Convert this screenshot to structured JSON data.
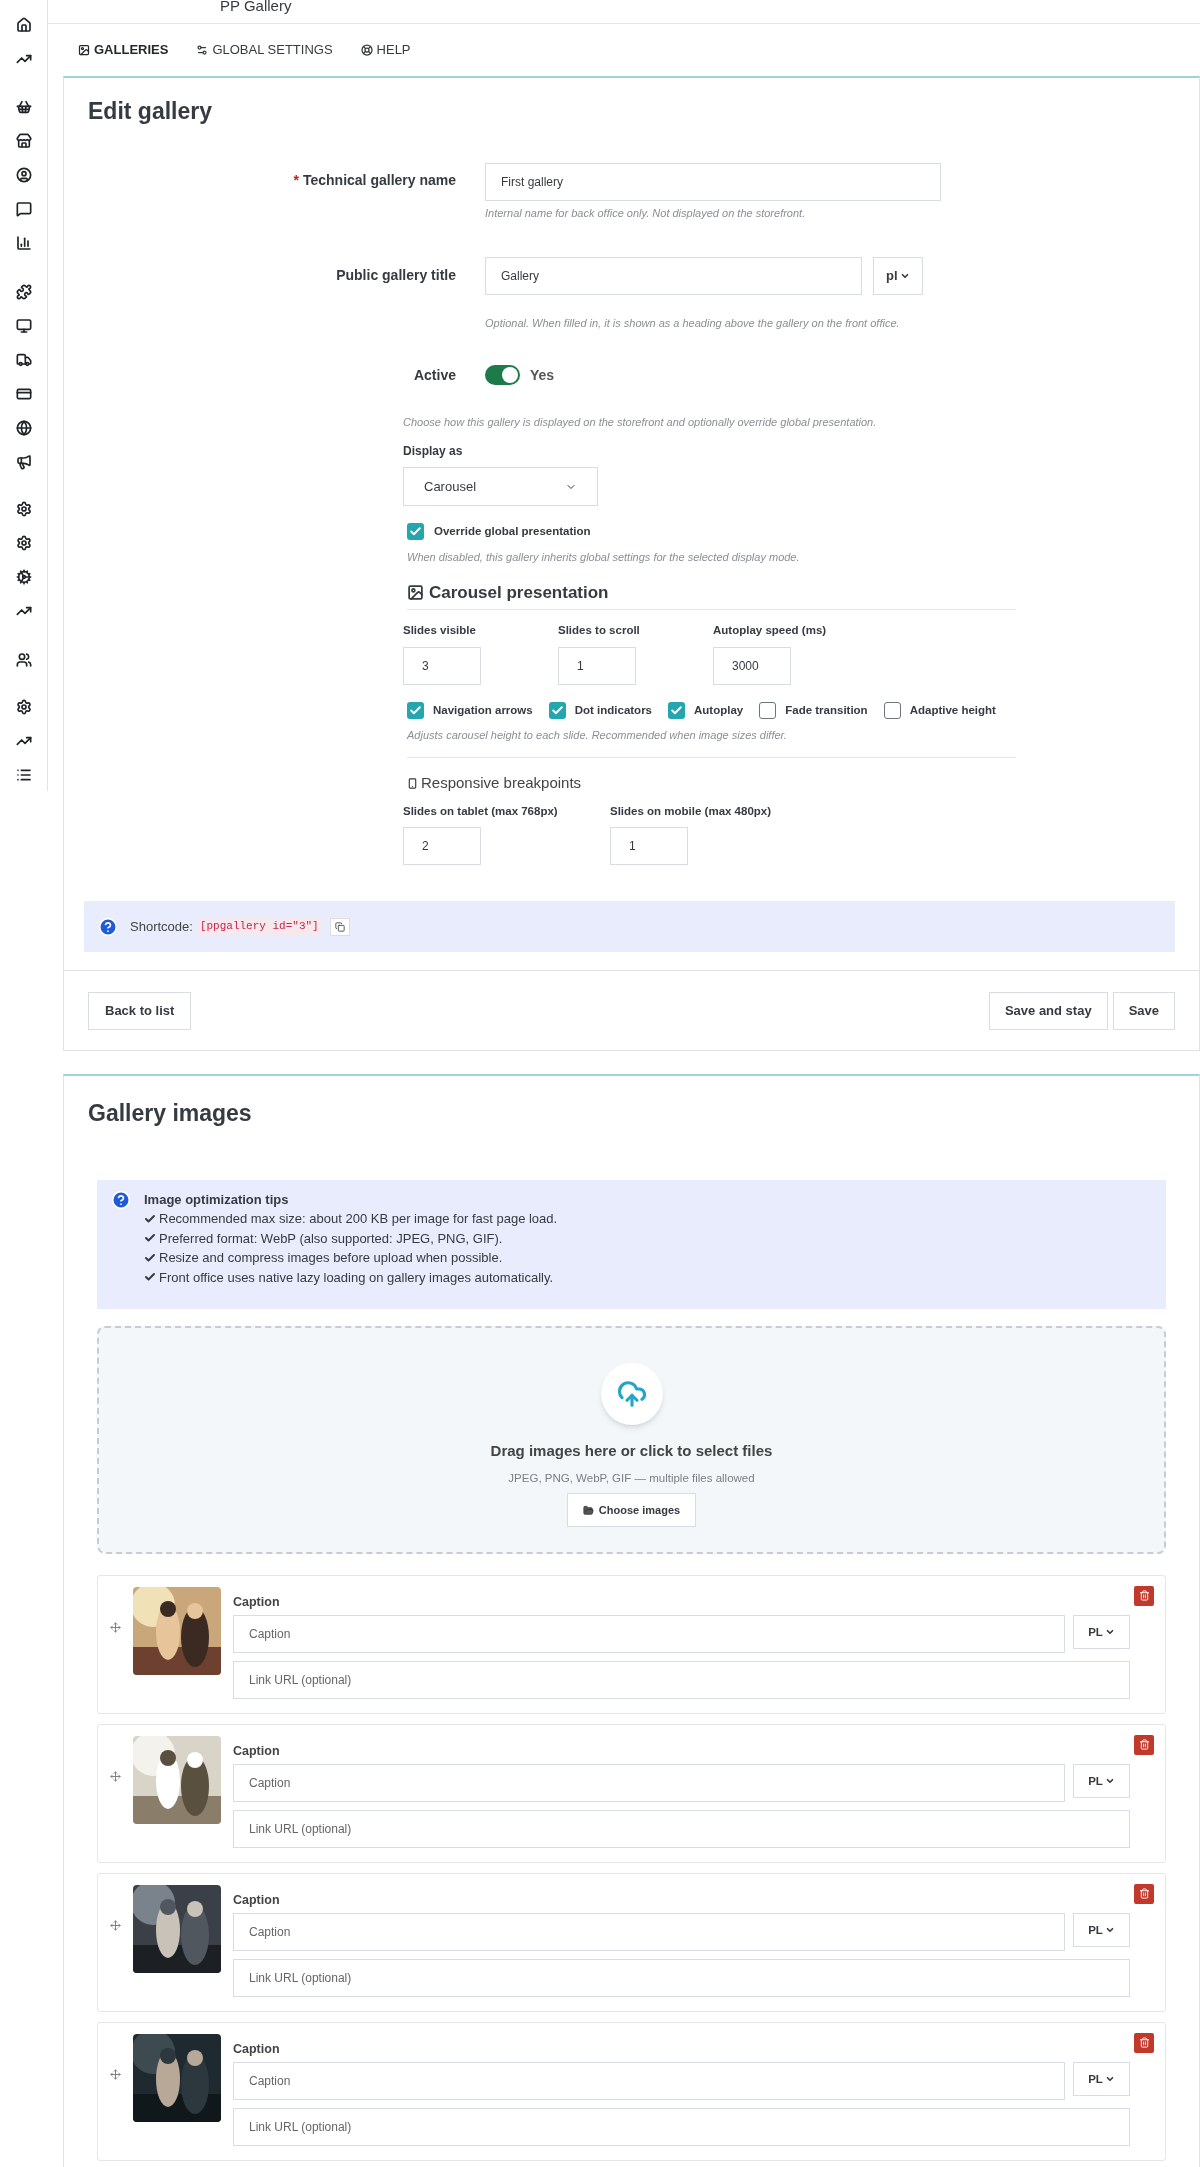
{
  "header": {
    "title": "PP Gallery"
  },
  "tabs": [
    {
      "label": "GALLERIES",
      "selected": true
    },
    {
      "label": "GLOBAL SETTINGS",
      "selected": false
    },
    {
      "label": "HELP",
      "selected": false
    }
  ],
  "edit_panel": {
    "title": "Edit gallery",
    "technical_name": {
      "label": "Technical gallery name",
      "required_mark": "*",
      "value": "First gallery",
      "help": "Internal name for back office only. Not displayed on the storefront."
    },
    "public_title": {
      "label": "Public gallery title",
      "value": "Gallery",
      "lang": "pl",
      "help": "Optional. When filled in, it is shown as a heading above the gallery on the front office."
    },
    "active": {
      "label": "Active",
      "on": true,
      "text": "Yes"
    },
    "display_help": "Choose how this gallery is displayed on the storefront and optionally override global presentation.",
    "display_as": {
      "label": "Display as",
      "value": "Carousel"
    },
    "override": {
      "label": "Override global presentation",
      "checked": true,
      "help": "When disabled, this gallery inherits global settings for the selected display mode."
    },
    "carousel": {
      "title": "Carousel presentation",
      "fields": [
        {
          "label": "Slides visible",
          "value": "3"
        },
        {
          "label": "Slides to scroll",
          "value": "1"
        },
        {
          "label": "Autoplay speed (ms)",
          "value": "3000"
        }
      ],
      "options": [
        {
          "label": "Navigation arrows",
          "checked": true
        },
        {
          "label": "Dot indicators",
          "checked": true
        },
        {
          "label": "Autoplay",
          "checked": true
        },
        {
          "label": "Fade transition",
          "checked": false
        },
        {
          "label": "Adaptive height",
          "checked": false
        }
      ],
      "help": "Adjusts carousel height to each slide. Recommended when image sizes differ."
    },
    "responsive": {
      "title": "Responsive breakpoints",
      "fields": [
        {
          "label": "Slides on tablet (max 768px)",
          "value": "2"
        },
        {
          "label": "Slides on mobile (max 480px)",
          "value": "1"
        }
      ]
    },
    "shortcode": {
      "label": "Shortcode:",
      "code": "[ppgallery id=\"3\"]"
    },
    "buttons": {
      "back": "Back to list",
      "save_stay": "Save and stay",
      "save": "Save"
    }
  },
  "images_panel": {
    "title": "Gallery images",
    "tips": {
      "title": "Image optimization tips",
      "items": [
        "Recommended max size: about 200 KB per image for fast page load.",
        "Preferred format: WebP (also supported: JPEG, PNG, GIF).",
        "Resize and compress images before upload when possible.",
        "Front office uses native lazy loading on gallery images automatically."
      ]
    },
    "dropzone": {
      "title": "Drag images here or click to select files",
      "subtitle": "JPEG, PNG, WebP, GIF — multiple files allowed",
      "button": "Choose images"
    },
    "images": [
      {
        "caption_label": "Caption",
        "caption_placeholder": "Caption",
        "lang": "PL",
        "link_placeholder": "Link URL (optional)"
      },
      {
        "caption_label": "Caption",
        "caption_placeholder": "Caption",
        "lang": "PL",
        "link_placeholder": "Link URL (optional)"
      },
      {
        "caption_label": "Caption",
        "caption_placeholder": "Caption",
        "lang": "PL",
        "link_placeholder": "Link URL (optional)"
      },
      {
        "caption_label": "Caption",
        "caption_placeholder": "Caption",
        "lang": "PL",
        "link_placeholder": "Link URL (optional)"
      }
    ]
  }
}
